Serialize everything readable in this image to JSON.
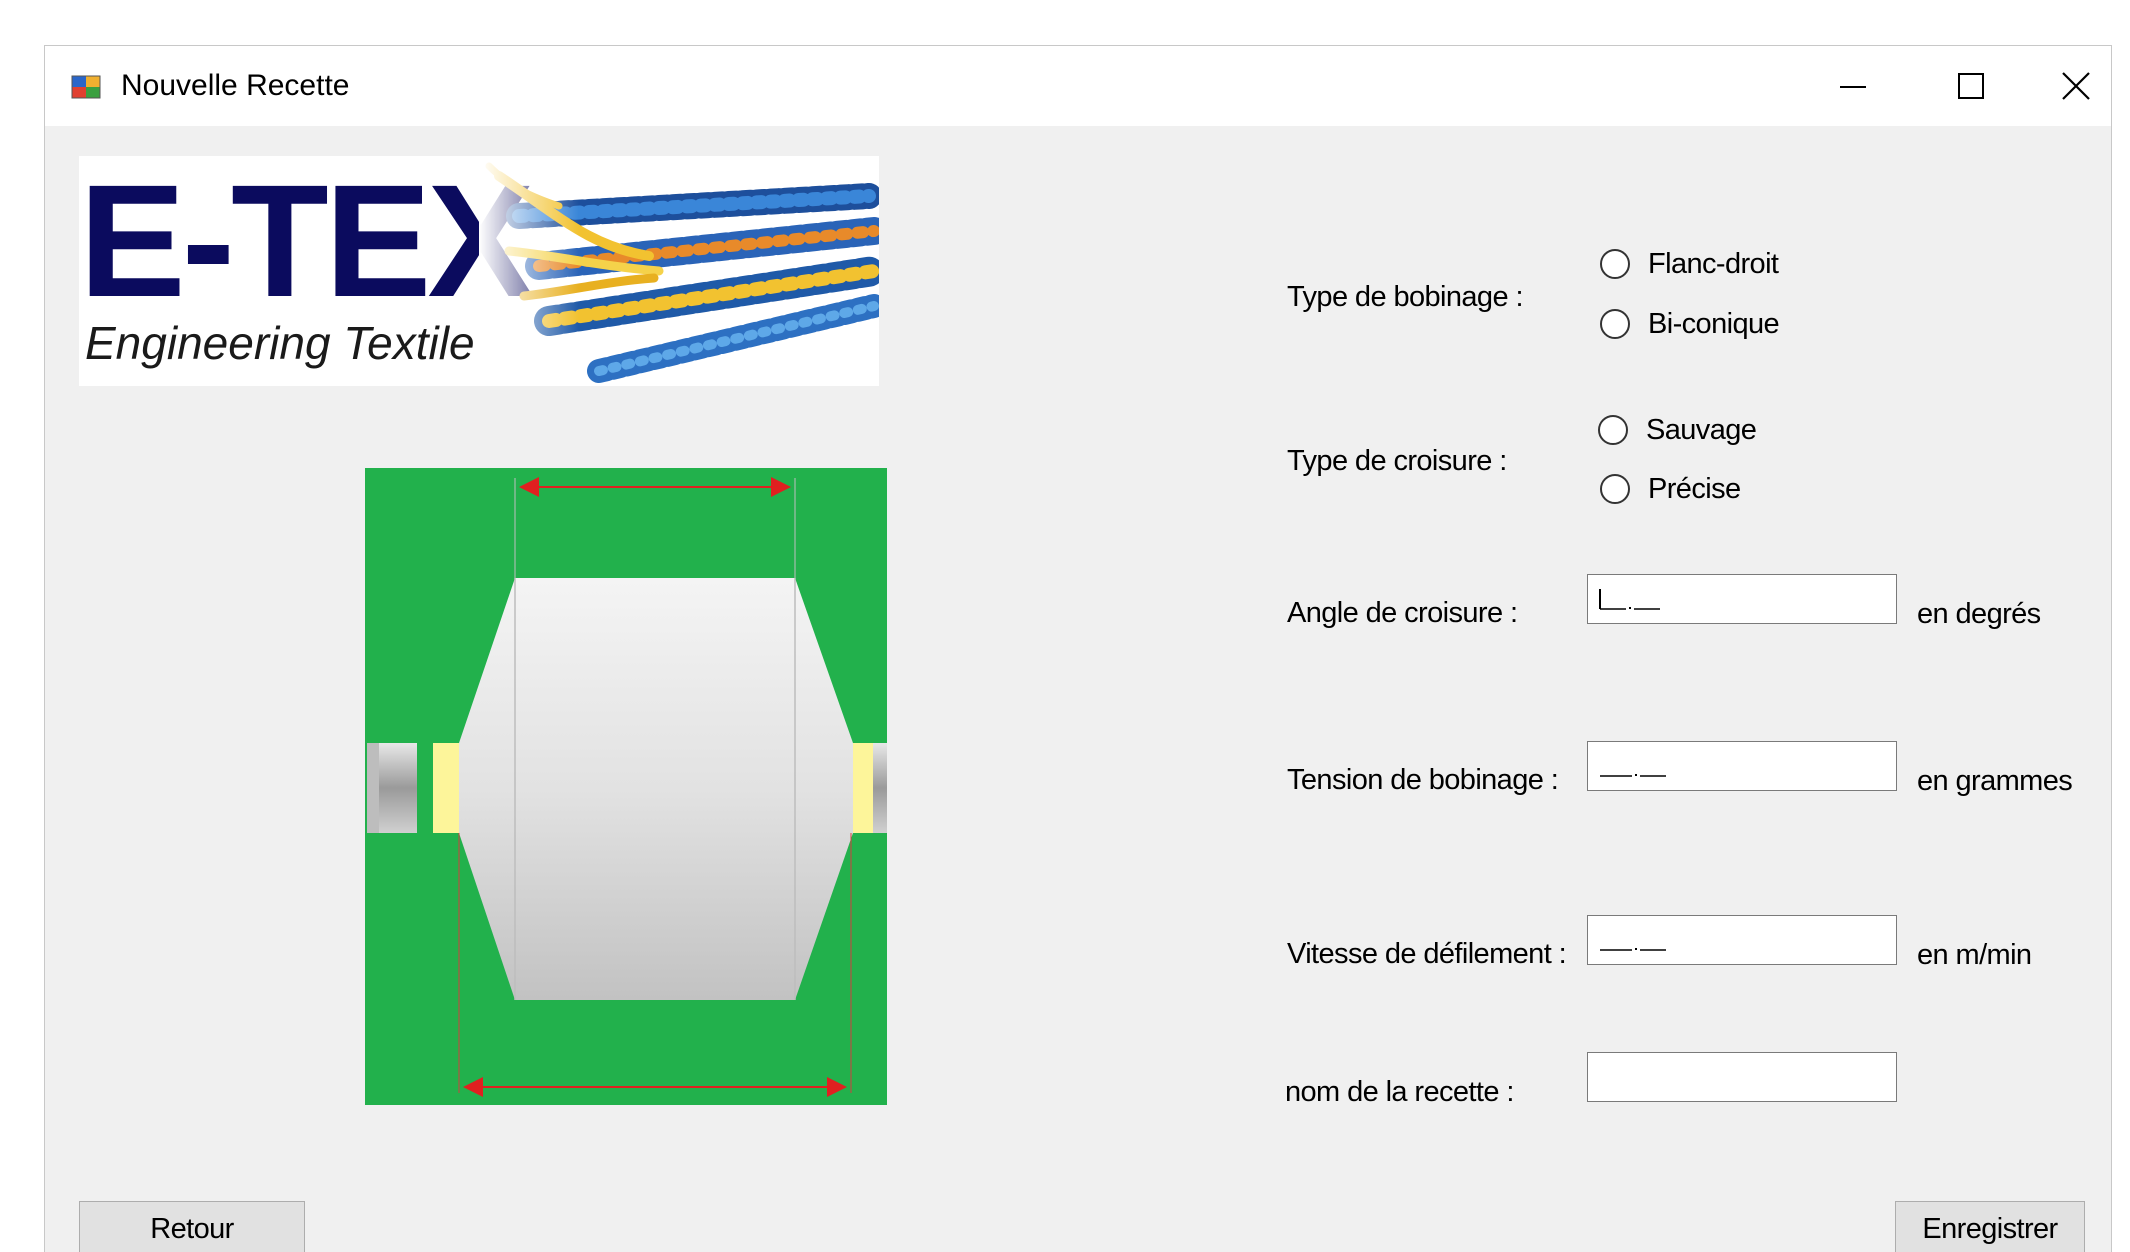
{
  "window": {
    "title": "Nouvelle Recette",
    "controls": {
      "minimize": "minimize-icon",
      "maximize": "maximize-icon",
      "close": "close-icon"
    }
  },
  "logo": {
    "brand": "E-TEX",
    "tagline": "Engineering Textile"
  },
  "form": {
    "winding_type": {
      "label": "Type de bobinage :",
      "options": [
        "Flanc-droit",
        "Bi-conique"
      ]
    },
    "crossing_type": {
      "label": "Type de croisure :",
      "options": [
        "Sauvage",
        "Précise"
      ]
    },
    "crossing_angle": {
      "label": "Angle de croisure :",
      "value": "",
      "unit": "en degrés"
    },
    "winding_tension": {
      "label": "Tension de bobinage :",
      "value": "",
      "unit": "en grammes"
    },
    "scroll_speed": {
      "label": "Vitesse de défilement :",
      "value": "",
      "unit": "en m/min"
    },
    "recipe_name": {
      "label": "nom de la recette :",
      "value": ""
    }
  },
  "buttons": {
    "back": "Retour",
    "save": "Enregistrer"
  },
  "colors": {
    "window_bg": "#f0f0f0",
    "diagram_bg": "#22b14c",
    "dimension_arrow": "#e02020",
    "logo_text": "#0b0b5e"
  }
}
